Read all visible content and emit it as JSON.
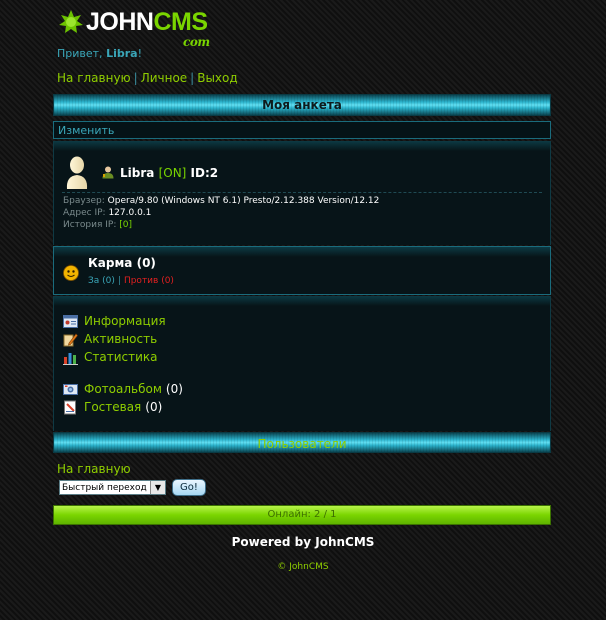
{
  "logo": {
    "john": "JOHN",
    "cms": "CMS",
    "sub": "com"
  },
  "greeting": {
    "prefix": "Привет, ",
    "name": "Libra",
    "suffix": "!"
  },
  "topnav": [
    "На главную",
    "Личное",
    "Выход"
  ],
  "header": {
    "title": "Моя анкета"
  },
  "edit_label": "Изменить",
  "profile": {
    "name": "Libra",
    "status": "[ON]",
    "id": "ID:2",
    "browser_label": "Браузер:",
    "browser_value": "Opera/9.80 (Windows NT 6.1) Presto/2.12.388 Version/12.12",
    "ip_label": "Адрес IP:",
    "ip_value": "127.0.0.1",
    "history_label": "История IP:",
    "history_value": "[0]"
  },
  "karma": {
    "title": "Карма (0)",
    "positive": "За (0)",
    "negative": "Против (0)"
  },
  "menu": {
    "info": "Информация",
    "activity": "Активность",
    "stats": "Статистика",
    "album": "Фотоальбом",
    "album_count": "(0)",
    "guestbook": "Гостевая",
    "guestbook_count": "(0)"
  },
  "users_bar": "Пользователи",
  "bottom": {
    "home": "На главную",
    "quick_select": "Быстрый переход",
    "go": "Go!"
  },
  "online": "Онлайн: 2 / 1",
  "footer": {
    "powered": "Powered by JohnCMS",
    "copyright": "© JohnCMS"
  },
  "colors": {
    "accent_green": "#8fce00",
    "accent_cyan": "#3aa6b8",
    "negative_red": "#e02020",
    "bar_cyan": "#2bb3cc",
    "online_green": "#7ad500"
  },
  "icons": [
    "logo-gear-icon",
    "avatar-silhouette-icon",
    "user-online-icon",
    "karma-smiley-icon",
    "info-card-icon",
    "activity-pencil-icon",
    "stats-bars-icon",
    "photo-album-icon",
    "guestbook-icon",
    "dropdown-arrow-icon"
  ]
}
